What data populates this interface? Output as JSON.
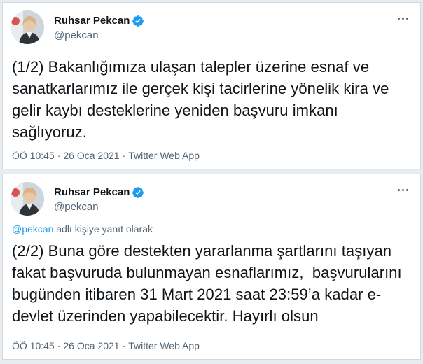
{
  "colors": {
    "page_background": "#e6ecf0",
    "card_background": "#ffffff",
    "link": "#1d9bf0",
    "secondary_text": "#536471",
    "verified_badge": "#1d9bf0"
  },
  "tweets": [
    {
      "author": {
        "name": "Ruhsar Pekcan",
        "handle": "@pekcan",
        "verified": true
      },
      "menu_icon": "more-horizontal-icon",
      "lines": [
        "(1/2) Bakanlığımıza ulaşan talepler üzerine esnaf ve",
        "sanatkarlarımız ile gerçek kişi tacirlerine yönelik kira ve",
        "gelir kaybı desteklerine yeniden başvuru imkanı",
        "sağlıyoruz."
      ],
      "time": "ÖÖ 10:45",
      "separator": "·",
      "date": "26 Oca 2021",
      "source": "Twitter Web App"
    },
    {
      "author": {
        "name": "Ruhsar Pekcan",
        "handle": "@pekcan",
        "verified": true
      },
      "menu_icon": "more-horizontal-icon",
      "reply_to": {
        "mention": "@pekcan",
        "suffix": " adlı kişiye yanıt olarak"
      },
      "lines": [
        "(2/2) Buna göre destekten yararlanma şartlarını taşıyan",
        "fakat başvuruda bulunmayan esnaflarımız,  başvurularını",
        "bugünden itibaren 31 Mart 2021 saat 23:59’a kadar e-",
        "devlet üzerinden yapabilecektir. Hayırlı olsun"
      ],
      "time": "ÖÖ 10:45",
      "separator": "·",
      "date": "26 Oca 2021",
      "source": "Twitter Web App"
    }
  ]
}
